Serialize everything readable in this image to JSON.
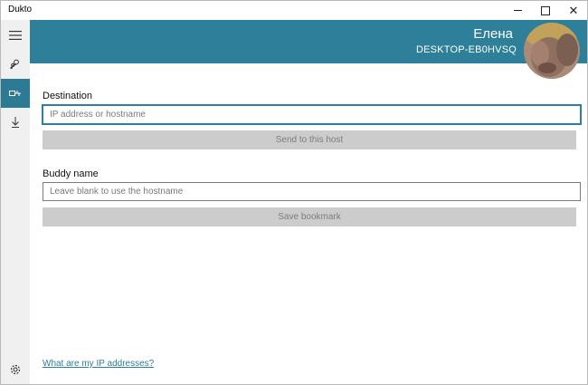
{
  "window": {
    "title": "Dukto"
  },
  "header": {
    "user_name": "Елена",
    "host_name": "DESKTOP-EB0HVSQ"
  },
  "form": {
    "destination_label": "Destination",
    "destination_placeholder": "IP address or hostname",
    "send_label": "Send to this host",
    "buddy_label": "Buddy name",
    "buddy_placeholder": "Leave blank to use the hostname",
    "save_label": "Save bookmark"
  },
  "footer": {
    "ip_link": "What are my IP addresses?"
  },
  "colors": {
    "accent": "#2e7f99",
    "button_disabled": "#cccccc",
    "sidebar": "#f0f0f0"
  },
  "icons": [
    "hamburger-icon",
    "buddies-icon",
    "send-ip-icon",
    "download-icon",
    "settings-icon"
  ]
}
